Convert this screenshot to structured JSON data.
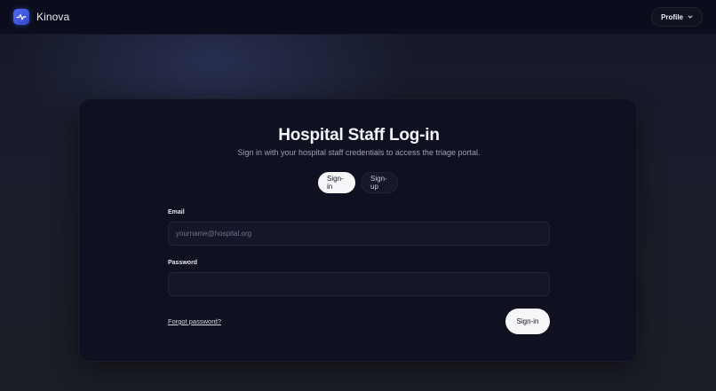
{
  "app": {
    "name": "Kinova",
    "logo_icon": "pulse-icon",
    "accent_color": "#4f6cf2"
  },
  "header": {
    "profile_label": "Profile",
    "profile_icon": "chevron-down-icon"
  },
  "login": {
    "title": "Hospital Staff Log-in",
    "subtitle": "Sign in with your hospital staff credentials to access the triage portal.",
    "tabs": [
      {
        "label": "Sign-in",
        "active": true
      },
      {
        "label": "Sign-up",
        "active": false
      }
    ],
    "email": {
      "label": "Email",
      "placeholder": "yourname@hospital.org",
      "value": ""
    },
    "password": {
      "label": "Password",
      "placeholder": "",
      "value": ""
    },
    "forgot_label": "Forgot password?",
    "submit_label": "Sign-in"
  }
}
